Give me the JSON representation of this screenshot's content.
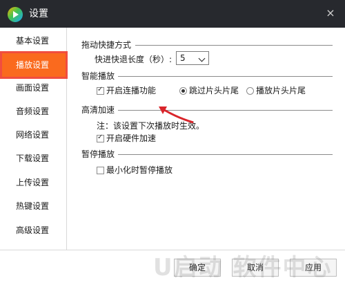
{
  "window": {
    "title": "设置",
    "close_label": "×"
  },
  "sidebar": {
    "items": [
      {
        "label": "基本设置"
      },
      {
        "label": "播放设置"
      },
      {
        "label": "画面设置"
      },
      {
        "label": "音频设置"
      },
      {
        "label": "网络设置"
      },
      {
        "label": "下载设置"
      },
      {
        "label": "上传设置"
      },
      {
        "label": "热键设置"
      },
      {
        "label": "高级设置"
      }
    ],
    "active_item": "播放设置"
  },
  "sections": {
    "drag_shortcut": {
      "title": "拖动快捷方式",
      "seek_length_label": "快进快退长度（秒）:",
      "seek_length_value": "5"
    },
    "smart_play": {
      "title": "智能播放",
      "continuous_play_label": "开启连播功能",
      "continuous_play_checked": true,
      "skip_intro_label": "跳过片头片尾",
      "skip_intro_selected": true,
      "play_intro_label": "播放片头片尾",
      "play_intro_selected": false
    },
    "hd_accel": {
      "title": "高清加速",
      "note": "注：该设置下次播放时生效。",
      "hardware_accel_label": "开启硬件加速",
      "hardware_accel_checked": true
    },
    "pause_play": {
      "title": "暂停播放",
      "minimize_pause_label": "最小化时暂停播放",
      "minimize_pause_checked": false
    }
  },
  "footer": {
    "ok_label": "确定",
    "cancel_label": "取消",
    "apply_label": "应用"
  },
  "watermark": "U启动 软件中心",
  "colors": {
    "titlebar": "#27292e",
    "active_nav": "#fa6a1e",
    "highlight_border": "#f14d3f",
    "annotation_arrow": "#d9252b"
  }
}
